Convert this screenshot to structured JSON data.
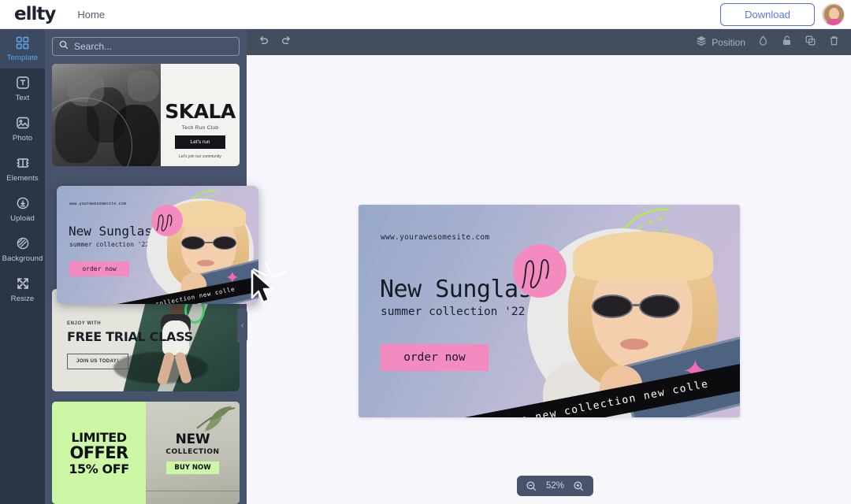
{
  "header": {
    "logo": "ellty",
    "nav_home": "Home",
    "download_label": "Download",
    "avatar_name": "user-avatar"
  },
  "rail": {
    "items": [
      {
        "label": "Template",
        "icon": "grid-icon",
        "active": true
      },
      {
        "label": "Text",
        "icon": "text-icon",
        "active": false
      },
      {
        "label": "Photo",
        "icon": "photo-icon",
        "active": false
      },
      {
        "label": "Elements",
        "icon": "elements-icon",
        "active": false
      },
      {
        "label": "Upload",
        "icon": "upload-icon",
        "active": false
      },
      {
        "label": "Background",
        "icon": "background-icon",
        "active": false
      },
      {
        "label": "Resize",
        "icon": "resize-icon",
        "active": false
      }
    ]
  },
  "panel": {
    "search_placeholder": "Search...",
    "search_value": "",
    "collapse_glyph": "‹",
    "templates": [
      {
        "name": "skala-template",
        "title": "SKALA",
        "subtitle": "Tech Run Club",
        "button": "Let's run",
        "note": "Let's join our community"
      },
      {
        "name": "sunglass-template",
        "url": "www.yourawesomesite.com",
        "title": "New Sunglass",
        "subtitle": "summer collection '22",
        "button": "order now",
        "ribbon": "tion new collection new collection new colle"
      },
      {
        "name": "tennis-template",
        "eyebrow": "ENJOY WITH",
        "title": "FREE TRIAL CLASS",
        "button": "JOIN US TODAY!"
      },
      {
        "name": "limited-offer-template",
        "line1": "LIMITED",
        "line2": "OFFER",
        "line3": "15% OFF",
        "right_title": "NEW",
        "right_sub": "COLLECTION",
        "right_button": "BUY NOW"
      }
    ]
  },
  "toolbar": {
    "undo_icon": "undo-icon",
    "redo_icon": "redo-icon",
    "position_label": "Position",
    "icons": [
      "layers-icon",
      "opacity-drop-icon",
      "unlock-icon",
      "duplicate-icon",
      "trash-icon"
    ]
  },
  "float_tools": {
    "icons": [
      "chevron-up-icon",
      "chevron-down-icon",
      "add-box-icon",
      "duplicate-add-icon",
      "trash-icon"
    ]
  },
  "canvas": {
    "url": "www.yourawesomesite.com",
    "title": "New Sunglass",
    "subtitle": "summer collection '22",
    "cta": "order now",
    "ribbon": "llection new collection new collection new colle"
  },
  "zoom": {
    "value": "52%",
    "out_icon": "zoom-out-icon",
    "in_icon": "zoom-in-icon"
  },
  "colors": {
    "rail_bg": "#2b3546",
    "panel_bg": "#47536b",
    "toolbar_bg": "#444d5e",
    "canvas_bg": "#f6f6fb",
    "accent_blue": "#4e6ef2",
    "active_blue": "#5ba7ee",
    "pink": "#f48bc0",
    "green": "#ccf7a5"
  }
}
